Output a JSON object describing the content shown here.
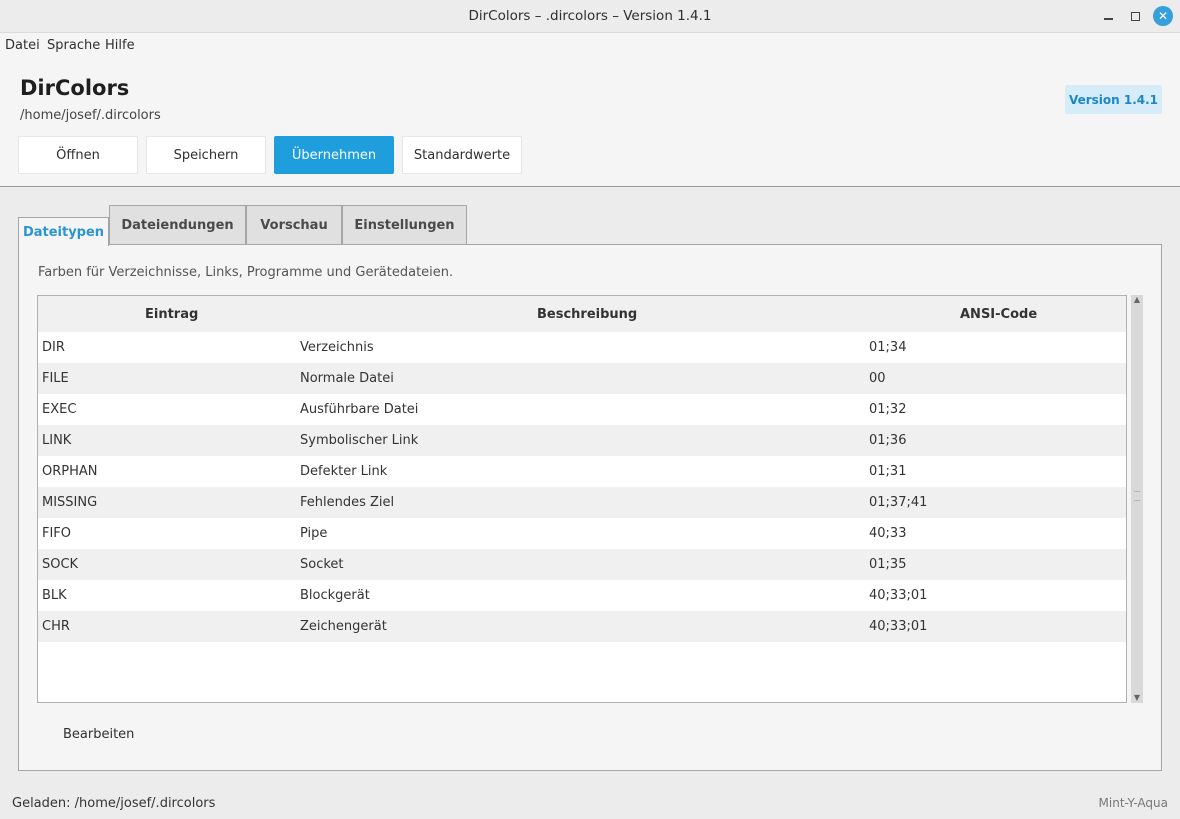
{
  "window": {
    "title": "DirColors – .dircolors – Version 1.4.1",
    "controls": [
      "minimize-icon",
      "maximize-icon",
      "close-icon"
    ]
  },
  "menu": [
    "Datei",
    "Sprache",
    "Hilfe"
  ],
  "header": {
    "app_title": "DirColors",
    "path": "/home/josef/.dircolors",
    "version_badge": "Version 1.4.1",
    "buttons": [
      "Öffnen",
      "Speichern",
      "Übernehmen",
      "Standardwerte"
    ]
  },
  "tabs": [
    "Dateitypen",
    "Dateiendungen",
    "Vorschau",
    "Einstellungen"
  ],
  "active_tab": "Dateitypen",
  "panel": {
    "description": "Farben für Verzeichnisse, Links, Programme und Gerätedateien.",
    "columns": [
      "Eintrag",
      "Beschreibung",
      "ANSI-Code"
    ],
    "rows": [
      [
        "DIR",
        "Verzeichnis",
        "01;34"
      ],
      [
        "FILE",
        "Normale Datei",
        "00"
      ],
      [
        "EXEC",
        "Ausführbare Datei",
        "01;32"
      ],
      [
        "LINK",
        "Symbolischer Link",
        "01;36"
      ],
      [
        "ORPHAN",
        "Defekter Link",
        "01;31"
      ],
      [
        "MISSING",
        "Fehlendes Ziel",
        "01;37;41"
      ],
      [
        "FIFO",
        "Pipe",
        "40;33"
      ],
      [
        "SOCK",
        "Socket",
        "01;35"
      ],
      [
        "BLK",
        "Blockgerät",
        "40;33;01"
      ],
      [
        "CHR",
        "Zeichengerät",
        "40;33;01"
      ]
    ],
    "edit_button": "Bearbeiten"
  },
  "status": {
    "left": "Geladen: /home/josef/.dircolors",
    "right": "Mint-Y-Aqua"
  },
  "colors": {
    "accent": "#1f9ede",
    "badge_bg": "#d6ecf8",
    "row_alt": "#f0f0f0"
  }
}
